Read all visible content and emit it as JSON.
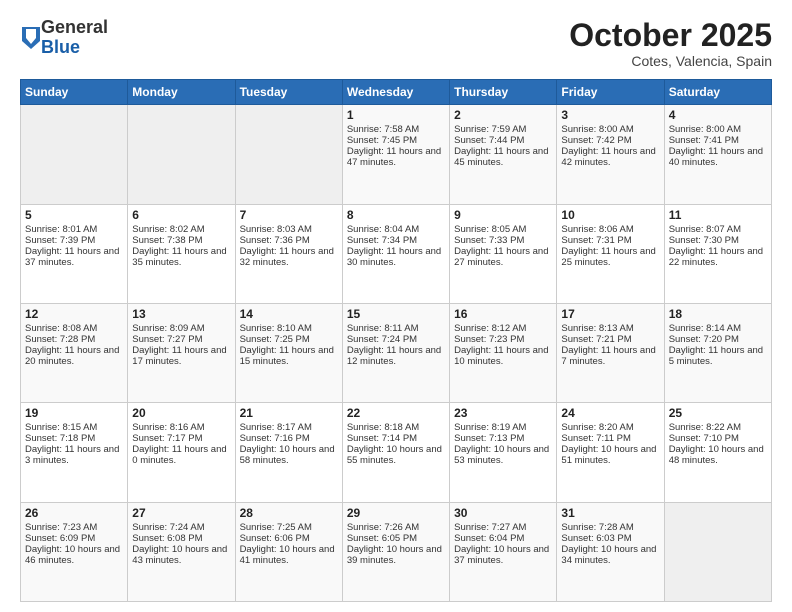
{
  "header": {
    "logo_general": "General",
    "logo_blue": "Blue",
    "month_title": "October 2025",
    "location": "Cotes, Valencia, Spain"
  },
  "days_of_week": [
    "Sunday",
    "Monday",
    "Tuesday",
    "Wednesday",
    "Thursday",
    "Friday",
    "Saturday"
  ],
  "weeks": [
    [
      {
        "day": "",
        "empty": true
      },
      {
        "day": "",
        "empty": true
      },
      {
        "day": "",
        "empty": true
      },
      {
        "day": "1",
        "sunrise": "Sunrise: 7:58 AM",
        "sunset": "Sunset: 7:45 PM",
        "daylight": "Daylight: 11 hours and 47 minutes."
      },
      {
        "day": "2",
        "sunrise": "Sunrise: 7:59 AM",
        "sunset": "Sunset: 7:44 PM",
        "daylight": "Daylight: 11 hours and 45 minutes."
      },
      {
        "day": "3",
        "sunrise": "Sunrise: 8:00 AM",
        "sunset": "Sunset: 7:42 PM",
        "daylight": "Daylight: 11 hours and 42 minutes."
      },
      {
        "day": "4",
        "sunrise": "Sunrise: 8:00 AM",
        "sunset": "Sunset: 7:41 PM",
        "daylight": "Daylight: 11 hours and 40 minutes."
      }
    ],
    [
      {
        "day": "5",
        "sunrise": "Sunrise: 8:01 AM",
        "sunset": "Sunset: 7:39 PM",
        "daylight": "Daylight: 11 hours and 37 minutes."
      },
      {
        "day": "6",
        "sunrise": "Sunrise: 8:02 AM",
        "sunset": "Sunset: 7:38 PM",
        "daylight": "Daylight: 11 hours and 35 minutes."
      },
      {
        "day": "7",
        "sunrise": "Sunrise: 8:03 AM",
        "sunset": "Sunset: 7:36 PM",
        "daylight": "Daylight: 11 hours and 32 minutes."
      },
      {
        "day": "8",
        "sunrise": "Sunrise: 8:04 AM",
        "sunset": "Sunset: 7:34 PM",
        "daylight": "Daylight: 11 hours and 30 minutes."
      },
      {
        "day": "9",
        "sunrise": "Sunrise: 8:05 AM",
        "sunset": "Sunset: 7:33 PM",
        "daylight": "Daylight: 11 hours and 27 minutes."
      },
      {
        "day": "10",
        "sunrise": "Sunrise: 8:06 AM",
        "sunset": "Sunset: 7:31 PM",
        "daylight": "Daylight: 11 hours and 25 minutes."
      },
      {
        "day": "11",
        "sunrise": "Sunrise: 8:07 AM",
        "sunset": "Sunset: 7:30 PM",
        "daylight": "Daylight: 11 hours and 22 minutes."
      }
    ],
    [
      {
        "day": "12",
        "sunrise": "Sunrise: 8:08 AM",
        "sunset": "Sunset: 7:28 PM",
        "daylight": "Daylight: 11 hours and 20 minutes."
      },
      {
        "day": "13",
        "sunrise": "Sunrise: 8:09 AM",
        "sunset": "Sunset: 7:27 PM",
        "daylight": "Daylight: 11 hours and 17 minutes."
      },
      {
        "day": "14",
        "sunrise": "Sunrise: 8:10 AM",
        "sunset": "Sunset: 7:25 PM",
        "daylight": "Daylight: 11 hours and 15 minutes."
      },
      {
        "day": "15",
        "sunrise": "Sunrise: 8:11 AM",
        "sunset": "Sunset: 7:24 PM",
        "daylight": "Daylight: 11 hours and 12 minutes."
      },
      {
        "day": "16",
        "sunrise": "Sunrise: 8:12 AM",
        "sunset": "Sunset: 7:23 PM",
        "daylight": "Daylight: 11 hours and 10 minutes."
      },
      {
        "day": "17",
        "sunrise": "Sunrise: 8:13 AM",
        "sunset": "Sunset: 7:21 PM",
        "daylight": "Daylight: 11 hours and 7 minutes."
      },
      {
        "day": "18",
        "sunrise": "Sunrise: 8:14 AM",
        "sunset": "Sunset: 7:20 PM",
        "daylight": "Daylight: 11 hours and 5 minutes."
      }
    ],
    [
      {
        "day": "19",
        "sunrise": "Sunrise: 8:15 AM",
        "sunset": "Sunset: 7:18 PM",
        "daylight": "Daylight: 11 hours and 3 minutes."
      },
      {
        "day": "20",
        "sunrise": "Sunrise: 8:16 AM",
        "sunset": "Sunset: 7:17 PM",
        "daylight": "Daylight: 11 hours and 0 minutes."
      },
      {
        "day": "21",
        "sunrise": "Sunrise: 8:17 AM",
        "sunset": "Sunset: 7:16 PM",
        "daylight": "Daylight: 10 hours and 58 minutes."
      },
      {
        "day": "22",
        "sunrise": "Sunrise: 8:18 AM",
        "sunset": "Sunset: 7:14 PM",
        "daylight": "Daylight: 10 hours and 55 minutes."
      },
      {
        "day": "23",
        "sunrise": "Sunrise: 8:19 AM",
        "sunset": "Sunset: 7:13 PM",
        "daylight": "Daylight: 10 hours and 53 minutes."
      },
      {
        "day": "24",
        "sunrise": "Sunrise: 8:20 AM",
        "sunset": "Sunset: 7:11 PM",
        "daylight": "Daylight: 10 hours and 51 minutes."
      },
      {
        "day": "25",
        "sunrise": "Sunrise: 8:22 AM",
        "sunset": "Sunset: 7:10 PM",
        "daylight": "Daylight: 10 hours and 48 minutes."
      }
    ],
    [
      {
        "day": "26",
        "sunrise": "Sunrise: 7:23 AM",
        "sunset": "Sunset: 6:09 PM",
        "daylight": "Daylight: 10 hours and 46 minutes."
      },
      {
        "day": "27",
        "sunrise": "Sunrise: 7:24 AM",
        "sunset": "Sunset: 6:08 PM",
        "daylight": "Daylight: 10 hours and 43 minutes."
      },
      {
        "day": "28",
        "sunrise": "Sunrise: 7:25 AM",
        "sunset": "Sunset: 6:06 PM",
        "daylight": "Daylight: 10 hours and 41 minutes."
      },
      {
        "day": "29",
        "sunrise": "Sunrise: 7:26 AM",
        "sunset": "Sunset: 6:05 PM",
        "daylight": "Daylight: 10 hours and 39 minutes."
      },
      {
        "day": "30",
        "sunrise": "Sunrise: 7:27 AM",
        "sunset": "Sunset: 6:04 PM",
        "daylight": "Daylight: 10 hours and 37 minutes."
      },
      {
        "day": "31",
        "sunrise": "Sunrise: 7:28 AM",
        "sunset": "Sunset: 6:03 PM",
        "daylight": "Daylight: 10 hours and 34 minutes."
      },
      {
        "day": "",
        "empty": true
      }
    ]
  ]
}
